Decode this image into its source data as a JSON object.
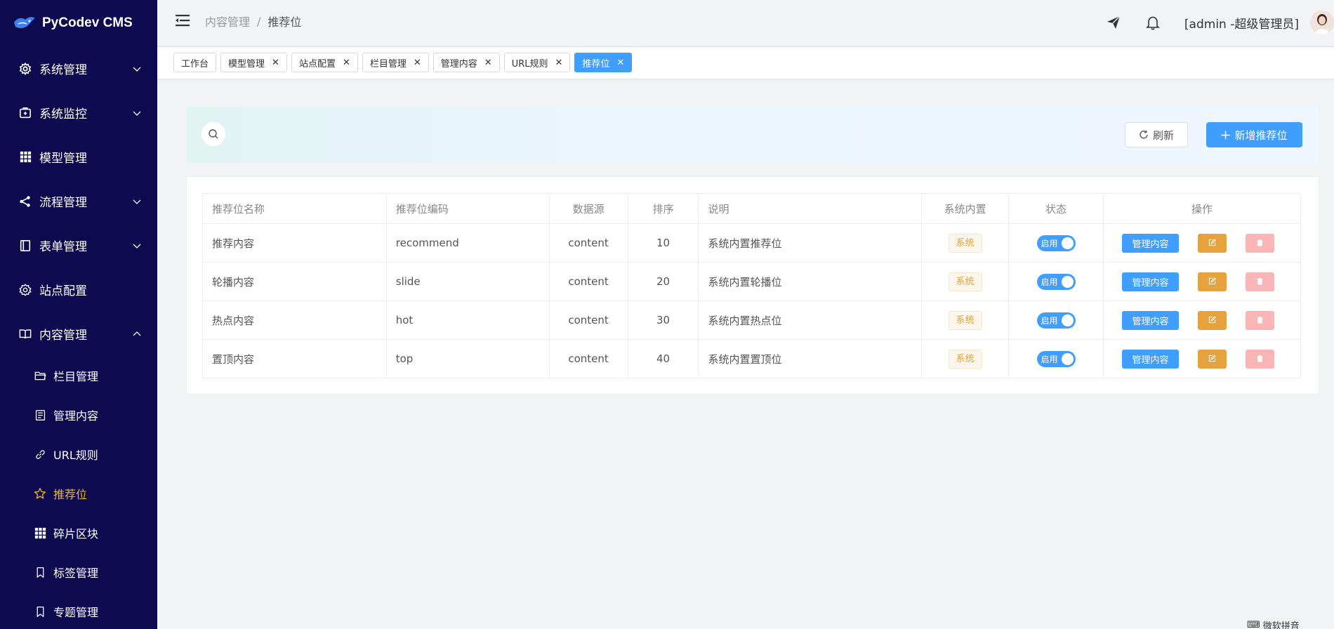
{
  "app": {
    "title": "PyCodev CMS"
  },
  "sidebar": {
    "items": [
      {
        "label": "系统管理",
        "icon": "gear-icon",
        "has_children": true,
        "expanded": false
      },
      {
        "label": "系统监控",
        "icon": "monitor-icon",
        "has_children": true,
        "expanded": false
      },
      {
        "label": "模型管理",
        "icon": "grid-icon",
        "has_children": false
      },
      {
        "label": "流程管理",
        "icon": "share-icon",
        "has_children": true,
        "expanded": false
      },
      {
        "label": "表单管理",
        "icon": "form-icon",
        "has_children": true,
        "expanded": false
      },
      {
        "label": "站点配置",
        "icon": "settings-icon",
        "has_children": false
      },
      {
        "label": "内容管理",
        "icon": "book-icon",
        "has_children": true,
        "expanded": true
      }
    ],
    "sub_items": [
      {
        "label": "栏目管理",
        "icon": "folder-icon",
        "active": false
      },
      {
        "label": "管理内容",
        "icon": "document-icon",
        "active": false
      },
      {
        "label": "URL规则",
        "icon": "link-icon",
        "active": false
      },
      {
        "label": "推荐位",
        "icon": "star-icon",
        "active": true
      },
      {
        "label": "碎片区块",
        "icon": "grid-icon",
        "active": false
      },
      {
        "label": "标签管理",
        "icon": "bookmark-icon",
        "active": false
      },
      {
        "label": "专题管理",
        "icon": "bookmark-icon",
        "active": false
      }
    ]
  },
  "header": {
    "breadcrumb": [
      "内容管理",
      "推荐位"
    ],
    "breadcrumb_separator": "/",
    "user": "[admin -超级管理员]"
  },
  "tabs": [
    {
      "label": "工作台",
      "closable": false,
      "active": false
    },
    {
      "label": "模型管理",
      "closable": true,
      "active": false
    },
    {
      "label": "站点配置",
      "closable": true,
      "active": false
    },
    {
      "label": "栏目管理",
      "closable": true,
      "active": false
    },
    {
      "label": "管理内容",
      "closable": true,
      "active": false
    },
    {
      "label": "URL规则",
      "closable": true,
      "active": false
    },
    {
      "label": "推荐位",
      "closable": true,
      "active": true
    }
  ],
  "toolbar": {
    "refresh_label": "刷新",
    "add_label": "新增推荐位"
  },
  "table": {
    "columns": [
      "推荐位名称",
      "推荐位编码",
      "数据源",
      "排序",
      "说明",
      "系统内置",
      "状态",
      "操作"
    ],
    "rows": [
      {
        "name": "推荐内容",
        "code": "recommend",
        "source": "content",
        "sort": "10",
        "desc": "系统内置推荐位",
        "builtin": "系统",
        "status": "启用"
      },
      {
        "name": "轮播内容",
        "code": "slide",
        "source": "content",
        "sort": "20",
        "desc": "系统内置轮播位",
        "builtin": "系统",
        "status": "启用"
      },
      {
        "name": "热点内容",
        "code": "hot",
        "source": "content",
        "sort": "30",
        "desc": "系统内置热点位",
        "builtin": "系统",
        "status": "启用"
      },
      {
        "name": "置顶内容",
        "code": "top",
        "source": "content",
        "sort": "40",
        "desc": "系统内置置顶位",
        "builtin": "系统",
        "status": "启用"
      }
    ],
    "manage_label": "管理内容"
  },
  "footer": {
    "corner_text": "微软拼音"
  },
  "colors": {
    "sidebar_bg": "#0d0a4f",
    "primary": "#409eff",
    "warning": "#e6a23c",
    "danger_light": "#fab6b6",
    "active_menu": "#f0b429"
  }
}
